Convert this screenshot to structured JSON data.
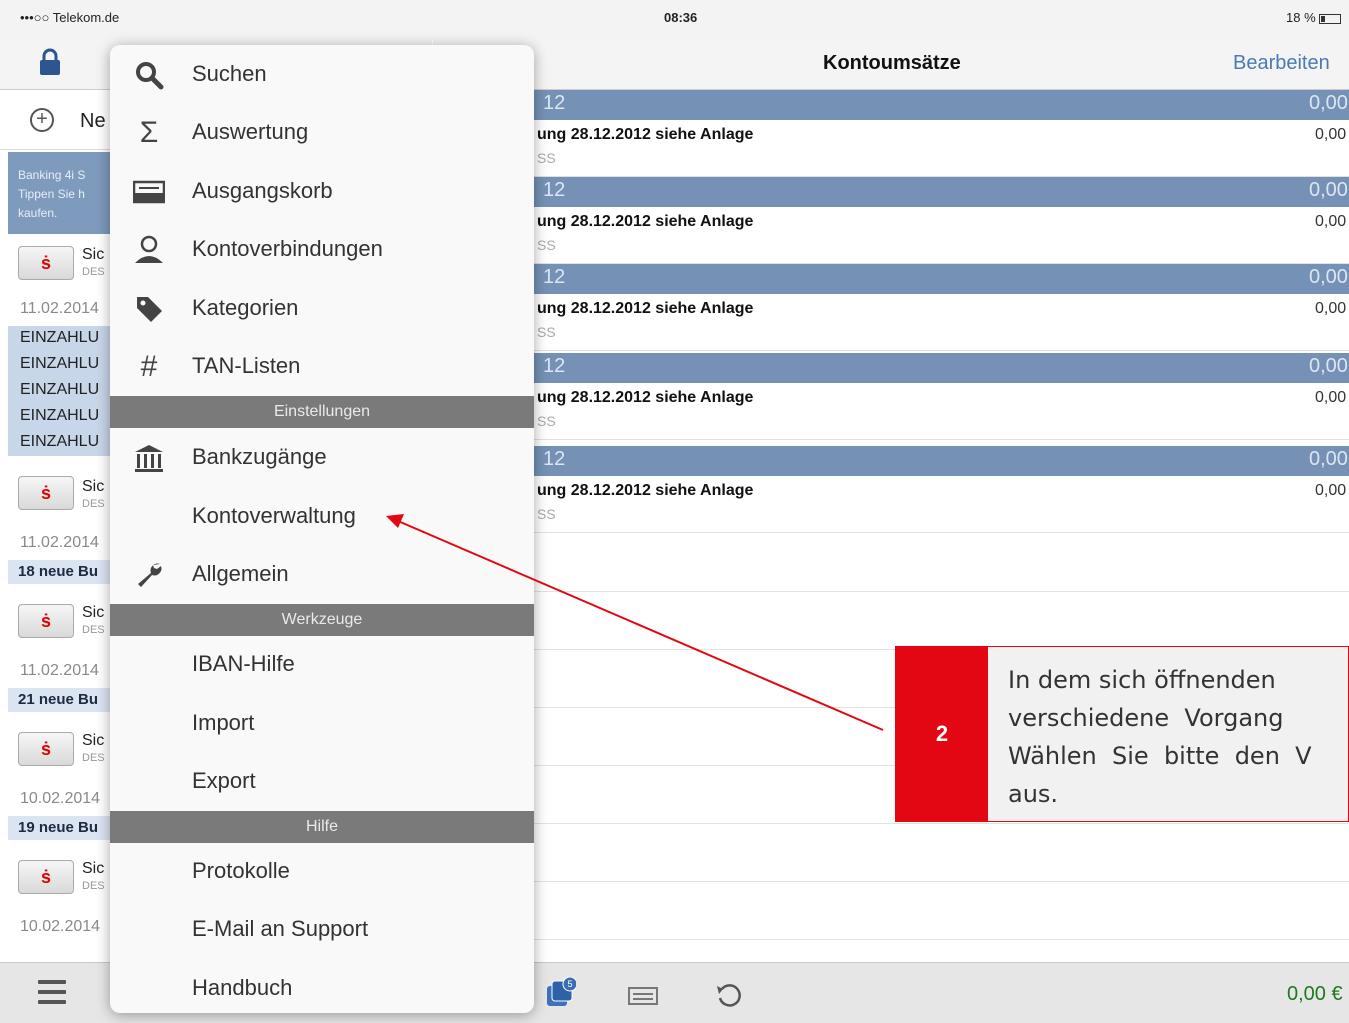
{
  "status_bar": {
    "carrier": "•••○○ Telekom.de",
    "time": "08:36",
    "battery": "18 %"
  },
  "master": {
    "new_label": "Ne",
    "banner_lines": [
      "Banking 4i S",
      "Tippen Sie h",
      "kaufen."
    ],
    "accounts": [
      {
        "name": "Sic",
        "sub": "DES",
        "date": "11.02.2014",
        "note": ""
      },
      {
        "name": "Sic",
        "sub": "DES",
        "date": "11.02.2014",
        "note": "18 neue Bu"
      },
      {
        "name": "Sic",
        "sub": "DES",
        "date": "11.02.2014",
        "note": "21 neue Bu"
      },
      {
        "name": "Sic",
        "sub": "DES",
        "date": "10.02.2014",
        "note": "19 neue Bu"
      },
      {
        "name": "Sic",
        "sub": "DES",
        "date": "10.02.2014",
        "note": ""
      }
    ],
    "einzahlungen": [
      "EINZAHLU",
      "EINZAHLU",
      "EINZAHLU",
      "EINZAHLU",
      "EINZAHLU"
    ]
  },
  "detail": {
    "title": "Kontoumsätze",
    "edit_label": "Bearbeiten",
    "sections": [
      {
        "year": "12",
        "amount": "0,00",
        "text": "ung 28.12.2012 siehe Anlage",
        "sub": "SS",
        "value": "0,00"
      },
      {
        "year": "12",
        "amount": "0,00",
        "text": "ung 28.12.2012 siehe Anlage",
        "sub": "SS",
        "value": "0,00"
      },
      {
        "year": "12",
        "amount": "0,00",
        "text": "ung 28.12.2012 siehe Anlage",
        "sub": "SS",
        "value": "0,00"
      },
      {
        "year": "12",
        "amount": "0,00",
        "text": "ung 28.12.2012 siehe Anlage",
        "sub": "SS",
        "value": "0,00"
      },
      {
        "year": "12",
        "amount": "0,00",
        "text": "ung 28.12.2012 siehe Anlage",
        "sub": "SS",
        "value": "0,00"
      }
    ]
  },
  "toolbar": {
    "badge": "5",
    "total": "0,00 €"
  },
  "menu": {
    "items_top": [
      {
        "label": "Suchen",
        "icon": "search-icon"
      },
      {
        "label": "Auswertung",
        "icon": "sigma-icon"
      },
      {
        "label": "Ausgangskorb",
        "icon": "outbox-icon"
      },
      {
        "label": "Kontoverbindungen",
        "icon": "person-icon"
      },
      {
        "label": "Kategorien",
        "icon": "tag-icon"
      },
      {
        "label": "TAN-Listen",
        "icon": "hash-icon"
      }
    ],
    "header_settings": "Einstellungen",
    "items_settings": [
      {
        "label": "Bankzugänge",
        "icon": "bank-icon"
      },
      {
        "label": "Kontoverwaltung",
        "icon": ""
      },
      {
        "label": "Allgemein",
        "icon": "wrench-icon"
      }
    ],
    "header_tools": "Werkzeuge",
    "items_tools": [
      {
        "label": "IBAN-Hilfe"
      },
      {
        "label": "Import"
      },
      {
        "label": "Export"
      }
    ],
    "header_help": "Hilfe",
    "items_help": [
      {
        "label": "Protokolle"
      },
      {
        "label": "E-Mail an Support"
      },
      {
        "label": "Handbuch"
      }
    ]
  },
  "annotation": {
    "number": "2",
    "text": "In dem sich öffnenden \nverschiedene  Vorgang\nWählen  Sie  bitte  den  V\naus.",
    "color": "#e30613"
  }
}
